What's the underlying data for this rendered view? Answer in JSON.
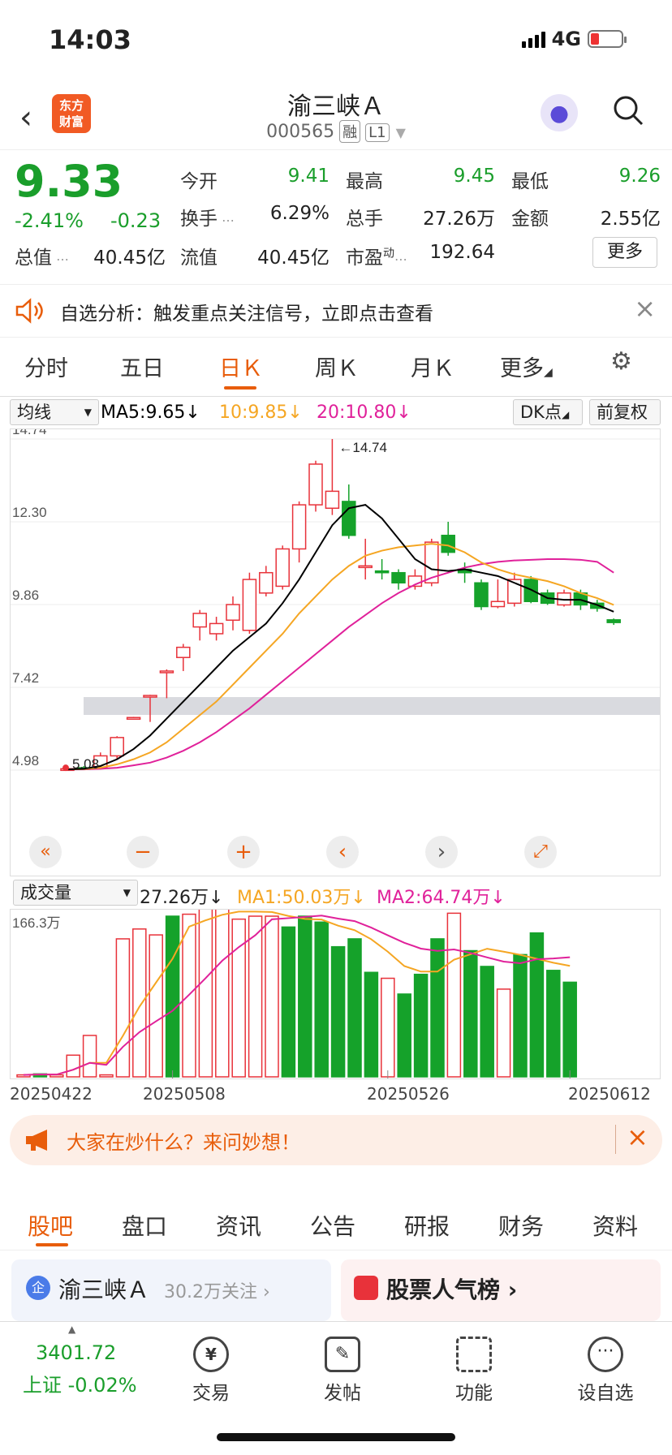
{
  "status": {
    "time": "14:03",
    "network": "4G"
  },
  "header": {
    "back": "‹",
    "logo_line1": "东方",
    "logo_line2": "财富",
    "name": "渝三峡Ａ",
    "code": "000565",
    "tag1": "融",
    "tag2": "L1"
  },
  "quote": {
    "price": "9.33",
    "pct": "-2.41%",
    "chg": "-0.23",
    "open_l": "今开",
    "open_v": "9.41",
    "high_l": "最高",
    "high_v": "9.45",
    "low_l": "最低",
    "low_v": "9.26",
    "turn_l": "换手",
    "turn_v": "6.29%",
    "vol_l": "总手",
    "vol_v": "27.26万",
    "amt_l": "金额",
    "amt_v": "2.55亿",
    "mcap_l": "总值",
    "mcap_v": "40.45亿",
    "float_l": "流值",
    "float_v": "40.45亿",
    "pe_l": "市盈",
    "pe_sup": "动",
    "pe_v": "192.64",
    "more": "更多"
  },
  "notice": {
    "text": "自选分析：触发重点关注信号，立即点击查看",
    "close": "×"
  },
  "tabs": [
    "分时",
    "五日",
    "日Ｋ",
    "周Ｋ",
    "月Ｋ",
    "更多",
    "⚙"
  ],
  "chartbar": {
    "ma_select": "均线",
    "ma5": "MA5:9.65↓",
    "ma10": "10:9.85↓",
    "ma20": "20:10.80↓",
    "dk": "DK点",
    "fq": "前复权"
  },
  "colors": {
    "up": "#e8323a",
    "down": "#15a22a",
    "ma5": "#000000",
    "ma10": "#f5a623",
    "ma20": "#e0219a",
    "accent": "#e85d0b"
  },
  "chart_data": {
    "type": "candlestick",
    "price_axis": [
      14.74,
      12.3,
      9.86,
      7.42,
      4.98
    ],
    "ylim": [
      4.98,
      14.74
    ],
    "high_label": "←14.74",
    "low_label": "5.08",
    "candles": [
      {
        "o": 5.0,
        "c": 5.02,
        "h": 5.08,
        "l": 4.98
      },
      {
        "o": 5.05,
        "c": 5.03,
        "h": 5.1,
        "l": 5.0
      },
      {
        "o": 5.05,
        "c": 5.4,
        "h": 5.5,
        "l": 5.0
      },
      {
        "o": 5.4,
        "c": 5.94,
        "h": 5.98,
        "l": 5.3
      },
      {
        "o": 6.53,
        "c": 6.53,
        "h": 6.55,
        "l": 6.5
      },
      {
        "o": 7.18,
        "c": 7.18,
        "h": 7.2,
        "l": 6.4
      },
      {
        "o": 7.9,
        "c": 7.9,
        "h": 7.95,
        "l": 7.1
      },
      {
        "o": 8.3,
        "c": 8.6,
        "h": 8.7,
        "l": 7.9
      },
      {
        "o": 9.2,
        "c": 9.6,
        "h": 9.7,
        "l": 8.8
      },
      {
        "o": 9.0,
        "c": 9.3,
        "h": 9.5,
        "l": 8.8
      },
      {
        "o": 9.4,
        "c": 9.86,
        "h": 10.1,
        "l": 9.1
      },
      {
        "o": 9.1,
        "c": 10.6,
        "h": 10.8,
        "l": 9.0
      },
      {
        "o": 10.2,
        "c": 10.8,
        "h": 11.0,
        "l": 10.1
      },
      {
        "o": 10.4,
        "c": 11.5,
        "h": 11.6,
        "l": 10.3
      },
      {
        "o": 11.5,
        "c": 12.8,
        "h": 12.9,
        "l": 11.1
      },
      {
        "o": 12.8,
        "c": 14.0,
        "h": 14.1,
        "l": 12.6
      },
      {
        "o": 12.7,
        "c": 13.2,
        "h": 14.74,
        "l": 12.5
      },
      {
        "o": 12.9,
        "c": 11.9,
        "h": 13.4,
        "l": 11.8
      },
      {
        "o": 11.0,
        "c": 11.0,
        "h": 11.8,
        "l": 10.6
      },
      {
        "o": 10.85,
        "c": 10.8,
        "h": 11.2,
        "l": 10.6
      },
      {
        "o": 10.8,
        "c": 10.5,
        "h": 10.9,
        "l": 10.3
      },
      {
        "o": 10.4,
        "c": 10.7,
        "h": 10.9,
        "l": 10.3
      },
      {
        "o": 10.5,
        "c": 11.7,
        "h": 11.8,
        "l": 10.4
      },
      {
        "o": 11.9,
        "c": 11.4,
        "h": 12.3,
        "l": 11.3
      },
      {
        "o": 10.9,
        "c": 10.8,
        "h": 11.1,
        "l": 10.5
      },
      {
        "o": 10.5,
        "c": 9.8,
        "h": 10.6,
        "l": 9.7
      },
      {
        "o": 9.8,
        "c": 9.95,
        "h": 10.6,
        "l": 9.75
      },
      {
        "o": 9.9,
        "c": 10.6,
        "h": 10.8,
        "l": 9.8
      },
      {
        "o": 10.6,
        "c": 9.95,
        "h": 10.7,
        "l": 9.9
      },
      {
        "o": 10.2,
        "c": 9.9,
        "h": 10.3,
        "l": 9.85
      },
      {
        "o": 9.85,
        "c": 10.2,
        "h": 10.3,
        "l": 9.8
      },
      {
        "o": 10.2,
        "c": 9.85,
        "h": 10.3,
        "l": 9.7
      },
      {
        "o": 9.9,
        "c": 9.75,
        "h": 10.0,
        "l": 9.65
      },
      {
        "o": 9.41,
        "c": 9.33,
        "h": 9.45,
        "l": 9.26
      }
    ],
    "ma5": [
      5.0,
      5.02,
      5.1,
      5.3,
      5.6,
      6.0,
      6.5,
      7.0,
      7.5,
      8.0,
      8.5,
      8.9,
      9.3,
      9.9,
      10.6,
      11.4,
      12.2,
      12.7,
      12.8,
      12.4,
      11.8,
      11.2,
      10.9,
      10.85,
      10.9,
      10.8,
      10.7,
      10.5,
      10.3,
      10.05,
      10.0,
      10.0,
      9.85,
      9.65
    ],
    "ma10": [
      5.0,
      5.01,
      5.05,
      5.15,
      5.3,
      5.5,
      5.8,
      6.2,
      6.6,
      7.0,
      7.5,
      8.0,
      8.5,
      9.0,
      9.6,
      10.1,
      10.6,
      11.0,
      11.3,
      11.45,
      11.55,
      11.6,
      11.65,
      11.6,
      11.4,
      11.1,
      10.9,
      10.75,
      10.65,
      10.55,
      10.4,
      10.2,
      10.05,
      9.85
    ],
    "ma20": [
      5.0,
      5.0,
      5.02,
      5.05,
      5.12,
      5.2,
      5.35,
      5.55,
      5.8,
      6.1,
      6.45,
      6.8,
      7.2,
      7.6,
      8.0,
      8.4,
      8.8,
      9.2,
      9.55,
      9.9,
      10.2,
      10.45,
      10.65,
      10.8,
      10.95,
      11.05,
      11.12,
      11.16,
      11.18,
      11.2,
      11.2,
      11.18,
      11.12,
      10.8
    ],
    "x_labels": [
      "20250422",
      "20250508",
      "20250526",
      "20250612"
    ],
    "volume": {
      "select": "成交量",
      "current": "27.26万↓",
      "ma1": "MA1:50.03万↓",
      "ma2": "MA2:64.74万↓",
      "max_label": "166.3万",
      "ylim": [
        0,
        166.3
      ],
      "values": [
        2,
        3,
        2,
        22,
        42,
        2,
        140,
        150,
        144,
        163,
        165,
        172,
        178,
        160,
        163,
        163,
        152,
        163,
        157,
        132,
        140,
        106,
        100,
        84,
        104,
        140,
        166,
        128,
        112,
        89,
        124,
        146,
        108,
        96,
        76,
        72,
        54
      ],
      "up_flags": [
        1,
        0,
        1,
        1,
        1,
        1,
        1,
        1,
        1,
        0,
        1,
        1,
        1,
        1,
        1,
        1,
        0,
        0,
        0,
        0,
        0,
        0,
        1,
        0,
        0,
        0,
        1,
        0,
        0,
        1,
        0,
        0,
        0,
        0
      ]
    }
  },
  "promo": {
    "text": "大家在炒什么？来问妙想！",
    "close": "×"
  },
  "tabs2": [
    "股吧",
    "盘口",
    "资讯",
    "公告",
    "研报",
    "财务",
    "资料"
  ],
  "cards": {
    "left_title": "渝三峡Ａ",
    "left_sub": "30.2万关注 ›",
    "right_title": "股票人气榜 ›"
  },
  "nav": {
    "index_val": "3401.72",
    "index_label": "上证 -0.02%",
    "n1": "交易",
    "n2": "发帖",
    "n3": "功能",
    "n4": "设自选"
  }
}
